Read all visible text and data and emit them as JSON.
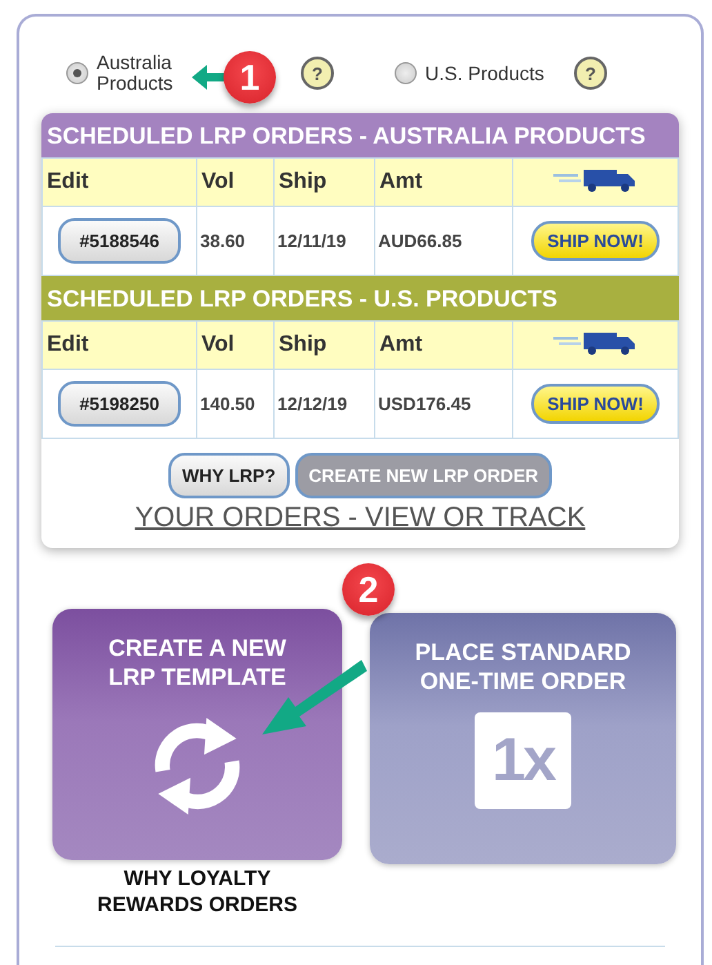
{
  "product_options": [
    {
      "label": "Australia Products",
      "selected": true,
      "help": "?"
    },
    {
      "label": "U.S. Products",
      "selected": false,
      "help": "?"
    }
  ],
  "order_sections": [
    {
      "kind": "australia",
      "title": "SCHEDULED LRP ORDERS - AUSTRALIA PRODUCTS",
      "columns": [
        "Edit",
        "Vol",
        "Ship",
        "Amt"
      ],
      "rows": [
        {
          "order": "#5188546",
          "vol": "38.60",
          "ship": "12/11/19",
          "amt": "AUD66.85",
          "action": "SHIP NOW!"
        }
      ]
    },
    {
      "kind": "us",
      "title": "SCHEDULED LRP ORDERS - U.S. PRODUCTS",
      "columns": [
        "Edit",
        "Vol",
        "Ship",
        "Amt"
      ],
      "rows": [
        {
          "order": "#5198250",
          "vol": "140.50",
          "ship": "12/12/19",
          "amt": "USD176.45",
          "action": "SHIP NOW!"
        }
      ]
    }
  ],
  "buttons": [
    {
      "label": "WHY LRP?",
      "disabled": false
    },
    {
      "label": "CREATE NEW LRP ORDER",
      "disabled": true
    }
  ],
  "orders_link": "YOUR ORDERS - VIEW OR TRACK",
  "tiles": [
    {
      "kind": "recurring",
      "title": "CREATE A NEW LRP TEMPLATE",
      "caption": "WHY LOYALTY REWARDS ORDERS"
    },
    {
      "kind": "one_time",
      "title": "PLACE STANDARD ONE-TIME ORDER",
      "badge": "1x"
    }
  ],
  "annotations": [
    {
      "number": "1"
    },
    {
      "number": "2"
    }
  ]
}
